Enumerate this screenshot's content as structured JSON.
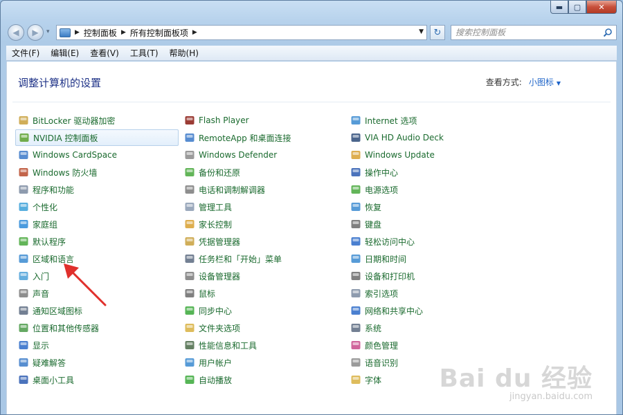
{
  "caption_buttons": {
    "minimize": "▬",
    "maximize": "▢",
    "close": "✕"
  },
  "nav": {
    "back": "◀",
    "forward": "▶",
    "dropdown": "▾"
  },
  "address": {
    "crumbs": [
      "控制面板",
      "所有控制面板项"
    ],
    "separator": "▶",
    "dropdown": "▼"
  },
  "refresh_glyph": "↻",
  "search": {
    "placeholder": "搜索控制面板"
  },
  "menubar": {
    "items": [
      "文件(F)",
      "编辑(E)",
      "查看(V)",
      "工具(T)",
      "帮助(H)"
    ]
  },
  "page": {
    "title": "调整计算机的设置",
    "view_by_label": "查看方式:",
    "view_by_value": "小图标",
    "caret": "▼"
  },
  "columns": [
    [
      {
        "label": "BitLocker 驱动器加密",
        "icon": "bitlocker-icon",
        "color": "#c8a03c"
      },
      {
        "label": "NVIDIA 控制面板",
        "icon": "nvidia-icon",
        "color": "#5aa02c",
        "selected": true
      },
      {
        "label": "Windows CardSpace",
        "icon": "cardspace-icon",
        "color": "#3a78c8"
      },
      {
        "label": "Windows 防火墙",
        "icon": "firewall-icon",
        "color": "#b84a2c"
      },
      {
        "label": "程序和功能",
        "icon": "programs-icon",
        "color": "#7a8aa0"
      },
      {
        "label": "个性化",
        "icon": "personalization-icon",
        "color": "#3aa0d8"
      },
      {
        "label": "家庭组",
        "icon": "homegroup-icon",
        "color": "#2c8ad8"
      },
      {
        "label": "默认程序",
        "icon": "default-programs-icon",
        "color": "#48a83c"
      },
      {
        "label": "区域和语言",
        "icon": "region-icon",
        "color": "#3a8ad0"
      },
      {
        "label": "入门",
        "icon": "getting-started-icon",
        "color": "#4aa0d8"
      },
      {
        "label": "声音",
        "icon": "sound-icon",
        "color": "#7a7a7a"
      },
      {
        "label": "通知区域图标",
        "icon": "notification-icon",
        "color": "#5a6a80"
      },
      {
        "label": "位置和其他传感器",
        "icon": "sensor-icon",
        "color": "#4a9a48"
      },
      {
        "label": "显示",
        "icon": "display-icon",
        "color": "#2c6ac8"
      },
      {
        "label": "疑难解答",
        "icon": "troubleshoot-icon",
        "color": "#3a7ac8"
      },
      {
        "label": "桌面小工具",
        "icon": "gadgets-icon",
        "color": "#2c5ab0"
      }
    ],
    [
      {
        "label": "Flash Player",
        "icon": "flash-icon",
        "color": "#8a1a12"
      },
      {
        "label": "RemoteApp 和桌面连接",
        "icon": "remoteapp-icon",
        "color": "#3a78c8"
      },
      {
        "label": "Windows Defender",
        "icon": "defender-icon",
        "color": "#8a8a8a"
      },
      {
        "label": "备份和还原",
        "icon": "backup-icon",
        "color": "#48a83c"
      },
      {
        "label": "电话和调制解调器",
        "icon": "phone-icon",
        "color": "#7a7a7a"
      },
      {
        "label": "管理工具",
        "icon": "admin-tools-icon",
        "color": "#8a9ab0"
      },
      {
        "label": "家长控制",
        "icon": "parental-icon",
        "color": "#d8a030"
      },
      {
        "label": "凭据管理器",
        "icon": "credential-icon",
        "color": "#c8a03c"
      },
      {
        "label": "任务栏和「开始」菜单",
        "icon": "taskbar-icon",
        "color": "#5a6a80"
      },
      {
        "label": "设备管理器",
        "icon": "device-manager-icon",
        "color": "#7a7a7a"
      },
      {
        "label": "鼠标",
        "icon": "mouse-icon",
        "color": "#6a6a6a"
      },
      {
        "label": "同步中心",
        "icon": "sync-icon",
        "color": "#38a838"
      },
      {
        "label": "文件夹选项",
        "icon": "folder-options-icon",
        "color": "#d8b040"
      },
      {
        "label": "性能信息和工具",
        "icon": "performance-icon",
        "color": "#4a6a48"
      },
      {
        "label": "用户帐户",
        "icon": "user-accounts-icon",
        "color": "#3a8ad0"
      },
      {
        "label": "自动播放",
        "icon": "autoplay-icon",
        "color": "#38a838"
      }
    ],
    [
      {
        "label": "Internet 选项",
        "icon": "internet-icon",
        "color": "#3a8ad0"
      },
      {
        "label": "VIA HD Audio Deck",
        "icon": "via-audio-icon",
        "color": "#2c4a78"
      },
      {
        "label": "Windows Update",
        "icon": "windows-update-icon",
        "color": "#d8a030"
      },
      {
        "label": "操作中心",
        "icon": "action-center-icon",
        "color": "#2c5ab0"
      },
      {
        "label": "电源选项",
        "icon": "power-icon",
        "color": "#48a83c"
      },
      {
        "label": "恢复",
        "icon": "recovery-icon",
        "color": "#3a8ad0"
      },
      {
        "label": "键盘",
        "icon": "keyboard-icon",
        "color": "#6a6a6a"
      },
      {
        "label": "轻松访问中心",
        "icon": "ease-access-icon",
        "color": "#2c6ac8"
      },
      {
        "label": "日期和时间",
        "icon": "datetime-icon",
        "color": "#3a8ad0"
      },
      {
        "label": "设备和打印机",
        "icon": "printer-icon",
        "color": "#6a6a6a"
      },
      {
        "label": "索引选项",
        "icon": "indexing-icon",
        "color": "#7a8aa0"
      },
      {
        "label": "网络和共享中心",
        "icon": "network-icon",
        "color": "#2c6ac8"
      },
      {
        "label": "系统",
        "icon": "system-icon",
        "color": "#5a6a80"
      },
      {
        "label": "颜色管理",
        "icon": "color-management-icon",
        "color": "#c84a8a"
      },
      {
        "label": "语音识别",
        "icon": "speech-icon",
        "color": "#8a8a8a"
      },
      {
        "label": "字体",
        "icon": "fonts-icon",
        "color": "#d8b040"
      }
    ]
  ],
  "watermark": {
    "logo": "Bai du 经验",
    "url": "jingyan.baidu.com"
  },
  "colors": {
    "link": "#1a6a2e",
    "title": "#1e3287",
    "accent": "#1e64c8",
    "arrow": "#e0302c"
  }
}
